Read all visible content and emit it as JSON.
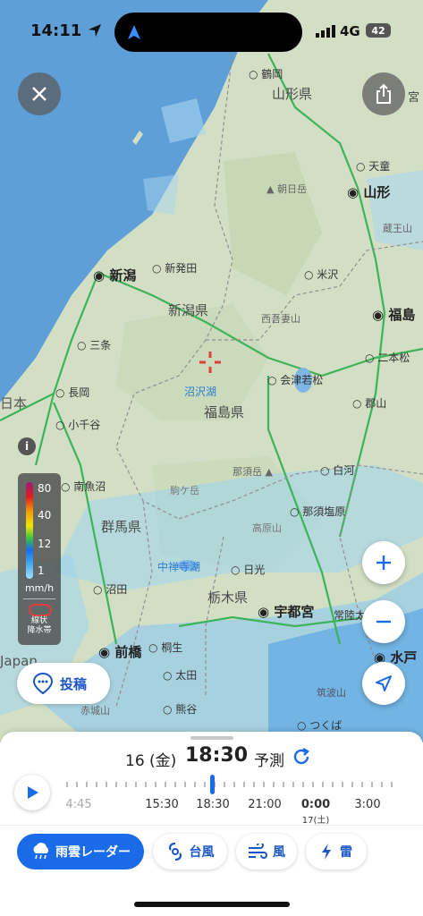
{
  "status_bar": {
    "time": "14:11",
    "network": "4G",
    "battery": "42"
  },
  "map": {
    "prefectures": [
      "山形県",
      "新潟県",
      "福島県",
      "群馬県",
      "栃木県"
    ],
    "cities_major": [
      "新潟",
      "山形",
      "福島",
      "会津若松",
      "宇都宮",
      "前橋",
      "水戸"
    ],
    "cities": [
      "鶴岡",
      "天童",
      "新発田",
      "米沢",
      "三条",
      "長岡",
      "二本松",
      "郡山",
      "小千谷",
      "白河",
      "南魚沼",
      "那須塩原",
      "日光",
      "沼田",
      "常陸太",
      "桐生",
      "太田",
      "熊谷",
      "つくば"
    ],
    "peaks": [
      "朝日岳",
      "西吾妻山",
      "那須岳",
      "駒ケ岳",
      "高原山",
      "筑波山",
      "蔵王山",
      "赤城山"
    ],
    "lakes": [
      "沼沢湖",
      "中禅寺湖"
    ],
    "side_text": [
      "日本",
      "Japan",
      "宮"
    ]
  },
  "legend": {
    "levels": [
      "80",
      "40",
      "12",
      "1"
    ],
    "unit": "mm/h",
    "senjo": "線状\n降水帯"
  },
  "post_button": {
    "label": "投稿"
  },
  "timeline": {
    "day": "16",
    "weekday": "(金)",
    "time": "18:30",
    "mode": "予測",
    "labels": [
      "4:45",
      "15:30",
      "18:30",
      "21:00",
      "0:00",
      "3:00"
    ],
    "sublabel": "17(土)"
  },
  "tabs": [
    {
      "label": "雨雲レーダー",
      "active": true
    },
    {
      "label": "台風",
      "active": false
    },
    {
      "label": "風",
      "active": false
    },
    {
      "label": "雷",
      "active": false
    }
  ],
  "colors": {
    "accent": "#1a6bea",
    "sea": "#5a9fd8",
    "land": "#d2dfc4"
  }
}
